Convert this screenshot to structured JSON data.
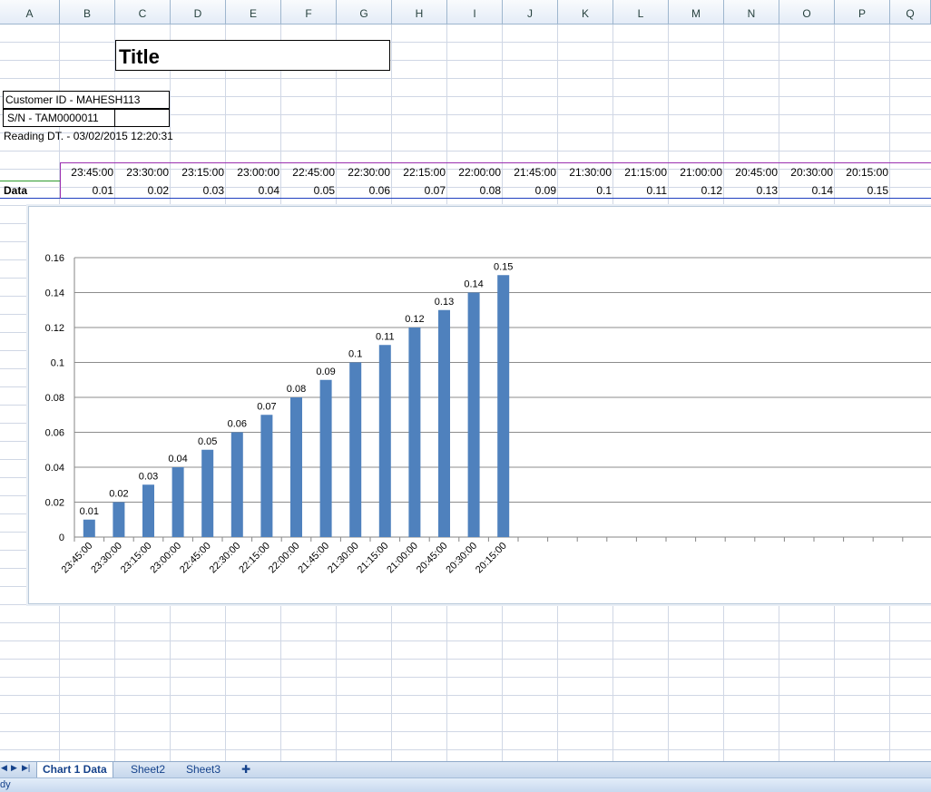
{
  "columns": [
    "A",
    "B",
    "C",
    "D",
    "E",
    "F",
    "G",
    "H",
    "I",
    "J",
    "K",
    "L",
    "M",
    "N",
    "O",
    "P",
    "Q"
  ],
  "sheet": {
    "title": "Title",
    "customer": "Customer ID - MAHESH113",
    "serial": "S/N - TAM0000011",
    "reading": "Reading DT. - 03/02/2015 12:20:31",
    "data_label": "Data",
    "times": [
      "23:45:00",
      "23:30:00",
      "23:15:00",
      "23:00:00",
      "22:45:00",
      "22:30:00",
      "22:15:00",
      "22:00:00",
      "21:45:00",
      "21:30:00",
      "21:15:00",
      "21:00:00",
      "20:45:00",
      "20:30:00",
      "20:15:00"
    ],
    "values": [
      "0.01",
      "0.02",
      "0.03",
      "0.04",
      "0.05",
      "0.06",
      "0.07",
      "0.08",
      "0.09",
      "0.1",
      "0.11",
      "0.12",
      "0.13",
      "0.14",
      "0.15"
    ]
  },
  "chart_data": {
    "type": "bar",
    "categories": [
      "23:45:00",
      "23:30:00",
      "23:15:00",
      "23:00:00",
      "22:45:00",
      "22:30:00",
      "22:15:00",
      "22:00:00",
      "21:45:00",
      "21:30:00",
      "21:15:00",
      "21:00:00",
      "20:45:00",
      "20:30:00",
      "20:15:00"
    ],
    "values": [
      0.01,
      0.02,
      0.03,
      0.04,
      0.05,
      0.06,
      0.07,
      0.08,
      0.09,
      0.1,
      0.11,
      0.12,
      0.13,
      0.14,
      0.15
    ],
    "data_labels": [
      "0.01",
      "0.02",
      "0.03",
      "0.04",
      "0.05",
      "0.06",
      "0.07",
      "0.08",
      "0.09",
      "0.1",
      "0.11",
      "0.12",
      "0.13",
      "0.14",
      "0.15"
    ],
    "yticks": [
      "0",
      "0.02",
      "0.04",
      "0.06",
      "0.08",
      "0.1",
      "0.12",
      "0.14",
      "0.16"
    ],
    "ylim": [
      0,
      0.16
    ],
    "grid": true,
    "bar_color": "#4f81bd"
  },
  "tabs": {
    "active": "Chart 1 Data",
    "sheet2": "Sheet2",
    "sheet3": "Sheet3"
  },
  "status": "dy",
  "colors": {
    "header_bg": "#dfe7f2",
    "gridline": "#d0d7e5",
    "tab_text": "#15428b"
  }
}
